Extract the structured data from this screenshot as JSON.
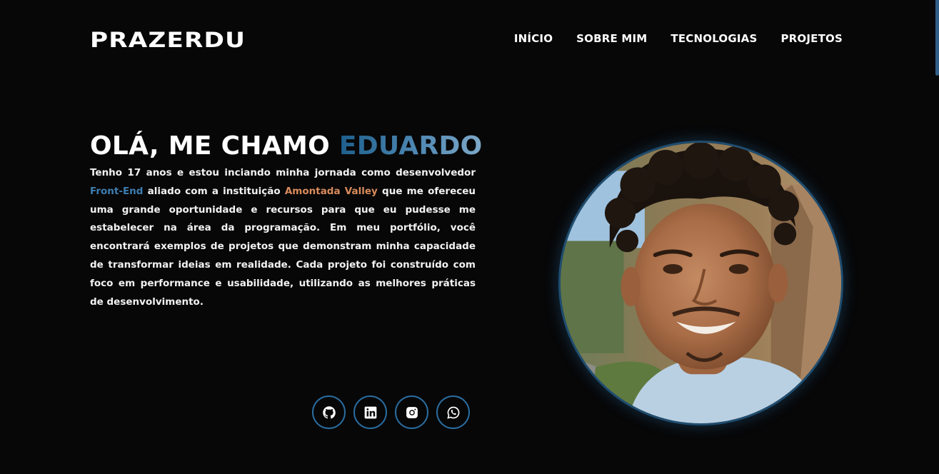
{
  "header": {
    "logo": "PRAZERDU",
    "nav": [
      "INÍCIO",
      "SOBRE MIM",
      "TECNOLOGIAS",
      "PROJETOS"
    ]
  },
  "hero": {
    "title_prefix": "OLÁ, ME CHAMO ",
    "title_name": "EDUARDO",
    "bio": {
      "part1": "Tenho 17 anos e estou inciando minha jornada como desenvolvedor ",
      "highlight_role": "Front-End",
      "part2": " aliado com a instituição ",
      "highlight_org": "Amontada Valley",
      "part3": " que me ofereceu uma grande oportunidade e recursos para que eu pudesse me estabelecer na área da programação. Em meu portfólio, você encontrará exemplos de projetos que demonstram minha capacidade de transformar ideias em realidade. Cada projeto foi construído com foco em performance e usabilidade, utilizando as melhores práticas de desenvolvimento."
    }
  },
  "socials": [
    {
      "icon": "github-icon"
    },
    {
      "icon": "linkedin-icon"
    },
    {
      "icon": "instagram-icon"
    },
    {
      "icon": "whatsapp-icon"
    }
  ],
  "colors": {
    "background": "#070708",
    "accent_blue": "#3f7db0",
    "accent_orange": "#d98b5b",
    "ring": "#2a6da0"
  }
}
